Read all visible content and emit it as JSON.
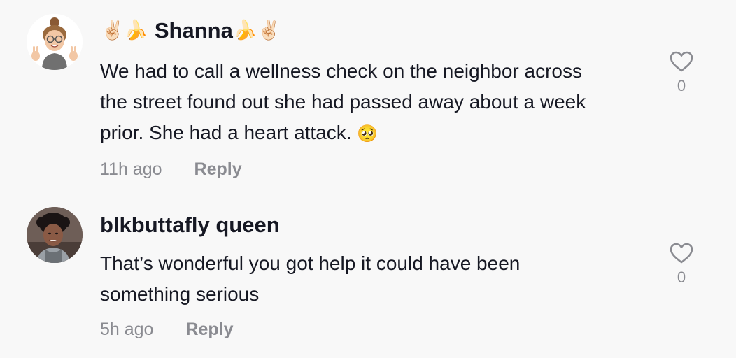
{
  "comments": [
    {
      "username_prefix_emoji": "✌🏻🍌",
      "username": "Shanna",
      "username_suffix_emoji": "🍌✌🏻",
      "text": "We had to call a wellness check on the neighbor across the street found out she had passed away about a week prior. She had a heart attack.",
      "text_emoji": "🥺",
      "time": "11h ago",
      "reply_label": "Reply",
      "likes": "0",
      "avatar_icon": "memoji-avatar-icon",
      "like_icon": "heart-outline-icon"
    },
    {
      "username_prefix_emoji": "",
      "username": "blkbuttafly queen",
      "username_suffix_emoji": "",
      "text": "That’s wonderful you got help it could have been something serious",
      "text_emoji": "",
      "time": "5h ago",
      "reply_label": "Reply",
      "likes": "0",
      "avatar_icon": "profile-photo-icon",
      "like_icon": "heart-outline-icon"
    }
  ],
  "colors": {
    "background": "#f8f8f8",
    "primary_text": "#161823",
    "secondary_text": "#8a8b91"
  }
}
